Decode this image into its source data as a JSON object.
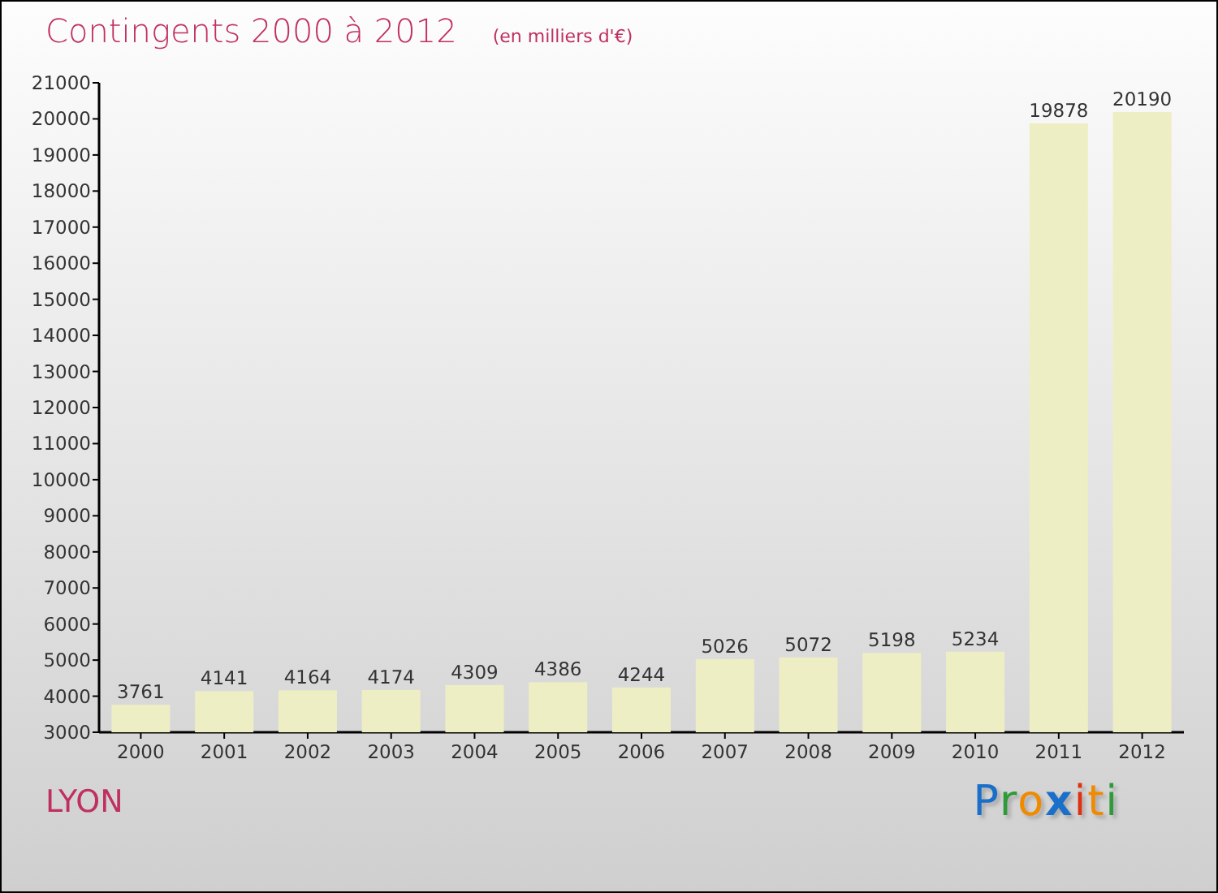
{
  "title": "Contingents 2000 à 2012",
  "unit": "(en milliers d'€)",
  "chart": {
    "chart_data": {
      "type": "bar",
      "categories": [
        "2000",
        "2001",
        "2002",
        "2003",
        "2004",
        "2005",
        "2006",
        "2007",
        "2008",
        "2009",
        "2010",
        "2011",
        "2012"
      ],
      "series": [
        {
          "color": "#eeeec4",
          "values": [
            3761,
            4141,
            4164,
            4174,
            4309,
            4386,
            4244,
            5026,
            5072,
            5198,
            5234,
            19878,
            20190
          ]
        }
      ],
      "ylim": [
        3000,
        21000
      ],
      "yticks": [
        3000,
        4000,
        5000,
        6000,
        7000,
        8000,
        9000,
        10000,
        11000,
        12000,
        13000,
        14000,
        15000,
        16000,
        17000,
        18000,
        19000,
        20000,
        21000
      ],
      "data_labels": true
    }
  },
  "place": "LYON",
  "logo": "Proxiti"
}
